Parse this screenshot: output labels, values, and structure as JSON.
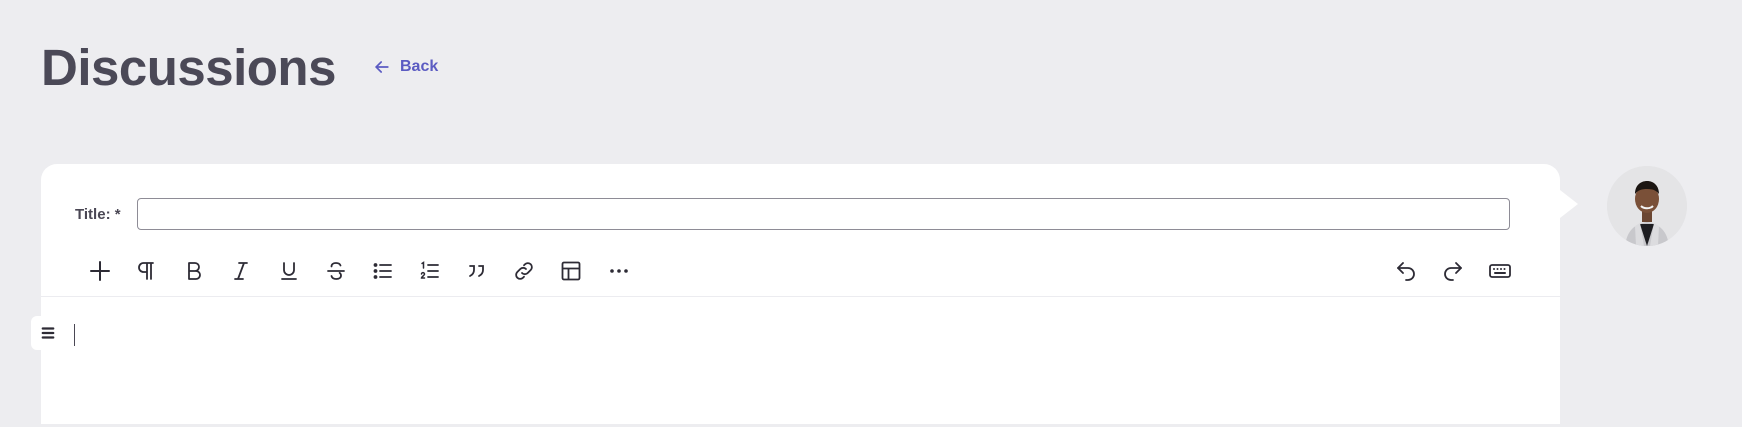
{
  "header": {
    "title": "Discussions",
    "back_label": "Back"
  },
  "form": {
    "title_label": "Title: *",
    "title_value": "",
    "title_placeholder": ""
  },
  "toolbar": {
    "left_tools": [
      "plus-icon",
      "paragraph-icon",
      "bold-icon",
      "italic-icon",
      "underline-icon",
      "strikethrough-icon",
      "bullet-list-icon",
      "ordered-list-icon",
      "blockquote-icon",
      "link-icon",
      "table-icon",
      "more-icon"
    ],
    "right_tools": [
      "undo-icon",
      "redo-icon",
      "keyboard-icon"
    ]
  },
  "editor": {
    "content": ""
  },
  "colors": {
    "background": "#ededf0",
    "card": "#ffffff",
    "accent": "#5b5bc2",
    "title_text": "#4b4957"
  }
}
